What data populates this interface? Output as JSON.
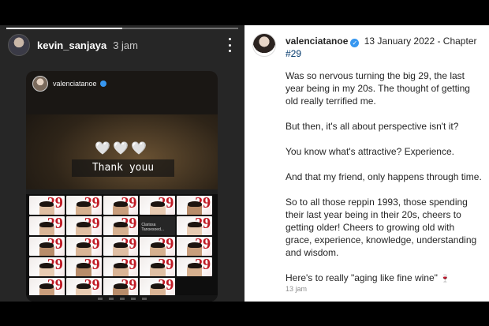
{
  "story": {
    "username": "kevin_sanjaya",
    "time": "3 jam",
    "progress": 0.5,
    "embedded_post": {
      "username": "valenciatanoe",
      "hearts": "🤍🤍🤍",
      "sticker_text": "Thank youu",
      "zoom_tile_name": "Clarissa Tanoesoed..."
    }
  },
  "post": {
    "username": "valenciatanoe",
    "verified_mark": "✓",
    "date_text": "13 January 2022 -",
    "chapter_text": "Chapter",
    "hashtag": "#29",
    "paragraphs": [
      "Was so nervous turning the big 29, the last year being in my 20s. The thought of getting old really terrified me.",
      "But then, it's all about perspective isn't it?",
      "You know what's attractive? Experience.",
      "And that my friend, only happens through time.",
      "So to all those reppin 1993, those spending their last year being in their 20s, cheers to getting older! Cheers to growing old with grace, experience, knowledge, understanding and wisdom."
    ],
    "last_line": "Here's to really \"aging like fine wine\"",
    "wine_emoji": "🍷",
    "time": "13 jam"
  },
  "colors": {
    "verified_blue": "#3797f0",
    "hashtag": "#00376b",
    "twentynine_red": "#c01b26"
  }
}
